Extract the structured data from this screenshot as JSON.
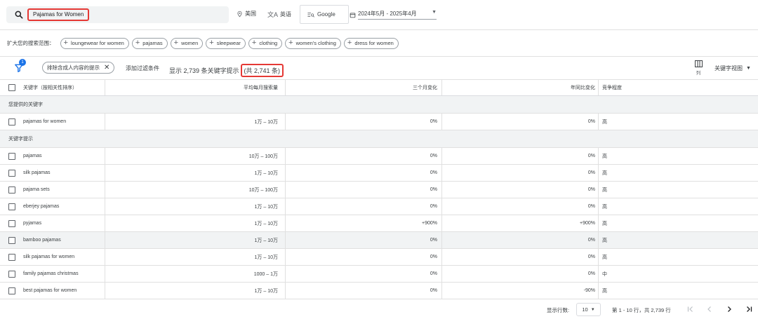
{
  "search": {
    "value": "Pajamas for Women"
  },
  "targeting": {
    "location": "美国",
    "language": "英语",
    "network": "Google",
    "date_range": "2024年5月 - 2025年4月"
  },
  "broaden": {
    "label": "扩大您的搜索范围：",
    "chips": [
      "loungewear for women",
      "pajamas",
      "women",
      "sleepwear",
      "clothing",
      "women's clothing",
      "dress for women"
    ]
  },
  "filters": {
    "badge_count": "1",
    "active_filter": "排除含成人内容的提示",
    "add_filter": "添加过滤条件",
    "showing": "显示 2,739 条关键字提示",
    "total": "(共 2,741 条)",
    "columns_label": "列",
    "view_label": "关键字视图"
  },
  "table": {
    "headers": {
      "keyword": "关键字（按相关性排序）",
      "avg_searches": "平均每月搜索量",
      "three_month": "三个月变化",
      "yoy": "年同比变化",
      "competition": "竞争程度"
    },
    "section_provided": "您提供的关键字",
    "section_ideas": "关键字提示",
    "provided_rows": [
      {
        "keyword": "pajamas for women",
        "avg": "1万 – 10万",
        "three_month": "0%",
        "yoy": "0%",
        "competition": "高"
      }
    ],
    "idea_rows": [
      {
        "keyword": "pajamas",
        "avg": "10万 – 100万",
        "three_month": "0%",
        "yoy": "0%",
        "competition": "高"
      },
      {
        "keyword": "silk pajamas",
        "avg": "1万 – 10万",
        "three_month": "0%",
        "yoy": "0%",
        "competition": "高"
      },
      {
        "keyword": "pajama sets",
        "avg": "10万 – 100万",
        "three_month": "0%",
        "yoy": "0%",
        "competition": "高"
      },
      {
        "keyword": "eberjey pajamas",
        "avg": "1万 – 10万",
        "three_month": "0%",
        "yoy": "0%",
        "competition": "高"
      },
      {
        "keyword": "pyjamas",
        "avg": "1万 – 10万",
        "three_month": "+900%",
        "yoy": "+900%",
        "competition": "高"
      },
      {
        "keyword": "bamboo pajamas",
        "avg": "1万 – 10万",
        "three_month": "0%",
        "yoy": "0%",
        "competition": "高"
      },
      {
        "keyword": "silk pajamas for women",
        "avg": "1万 – 10万",
        "three_month": "0%",
        "yoy": "0%",
        "competition": "高"
      },
      {
        "keyword": "family pajamas christmas",
        "avg": "1000 – 1万",
        "three_month": "0%",
        "yoy": "0%",
        "competition": "中"
      },
      {
        "keyword": "best pajamas for women",
        "avg": "1万 – 10万",
        "three_month": "0%",
        "yoy": "-90%",
        "competition": "高"
      }
    ]
  },
  "pagination": {
    "rows_label": "显示行数:",
    "rows_value": "10",
    "range_text": "第 1 - 10 行，共 2,739 行"
  },
  "colors": {
    "accent": "#1a73e8",
    "highlight_border": "#e53935",
    "row_highlight": "#f1f3f4"
  }
}
